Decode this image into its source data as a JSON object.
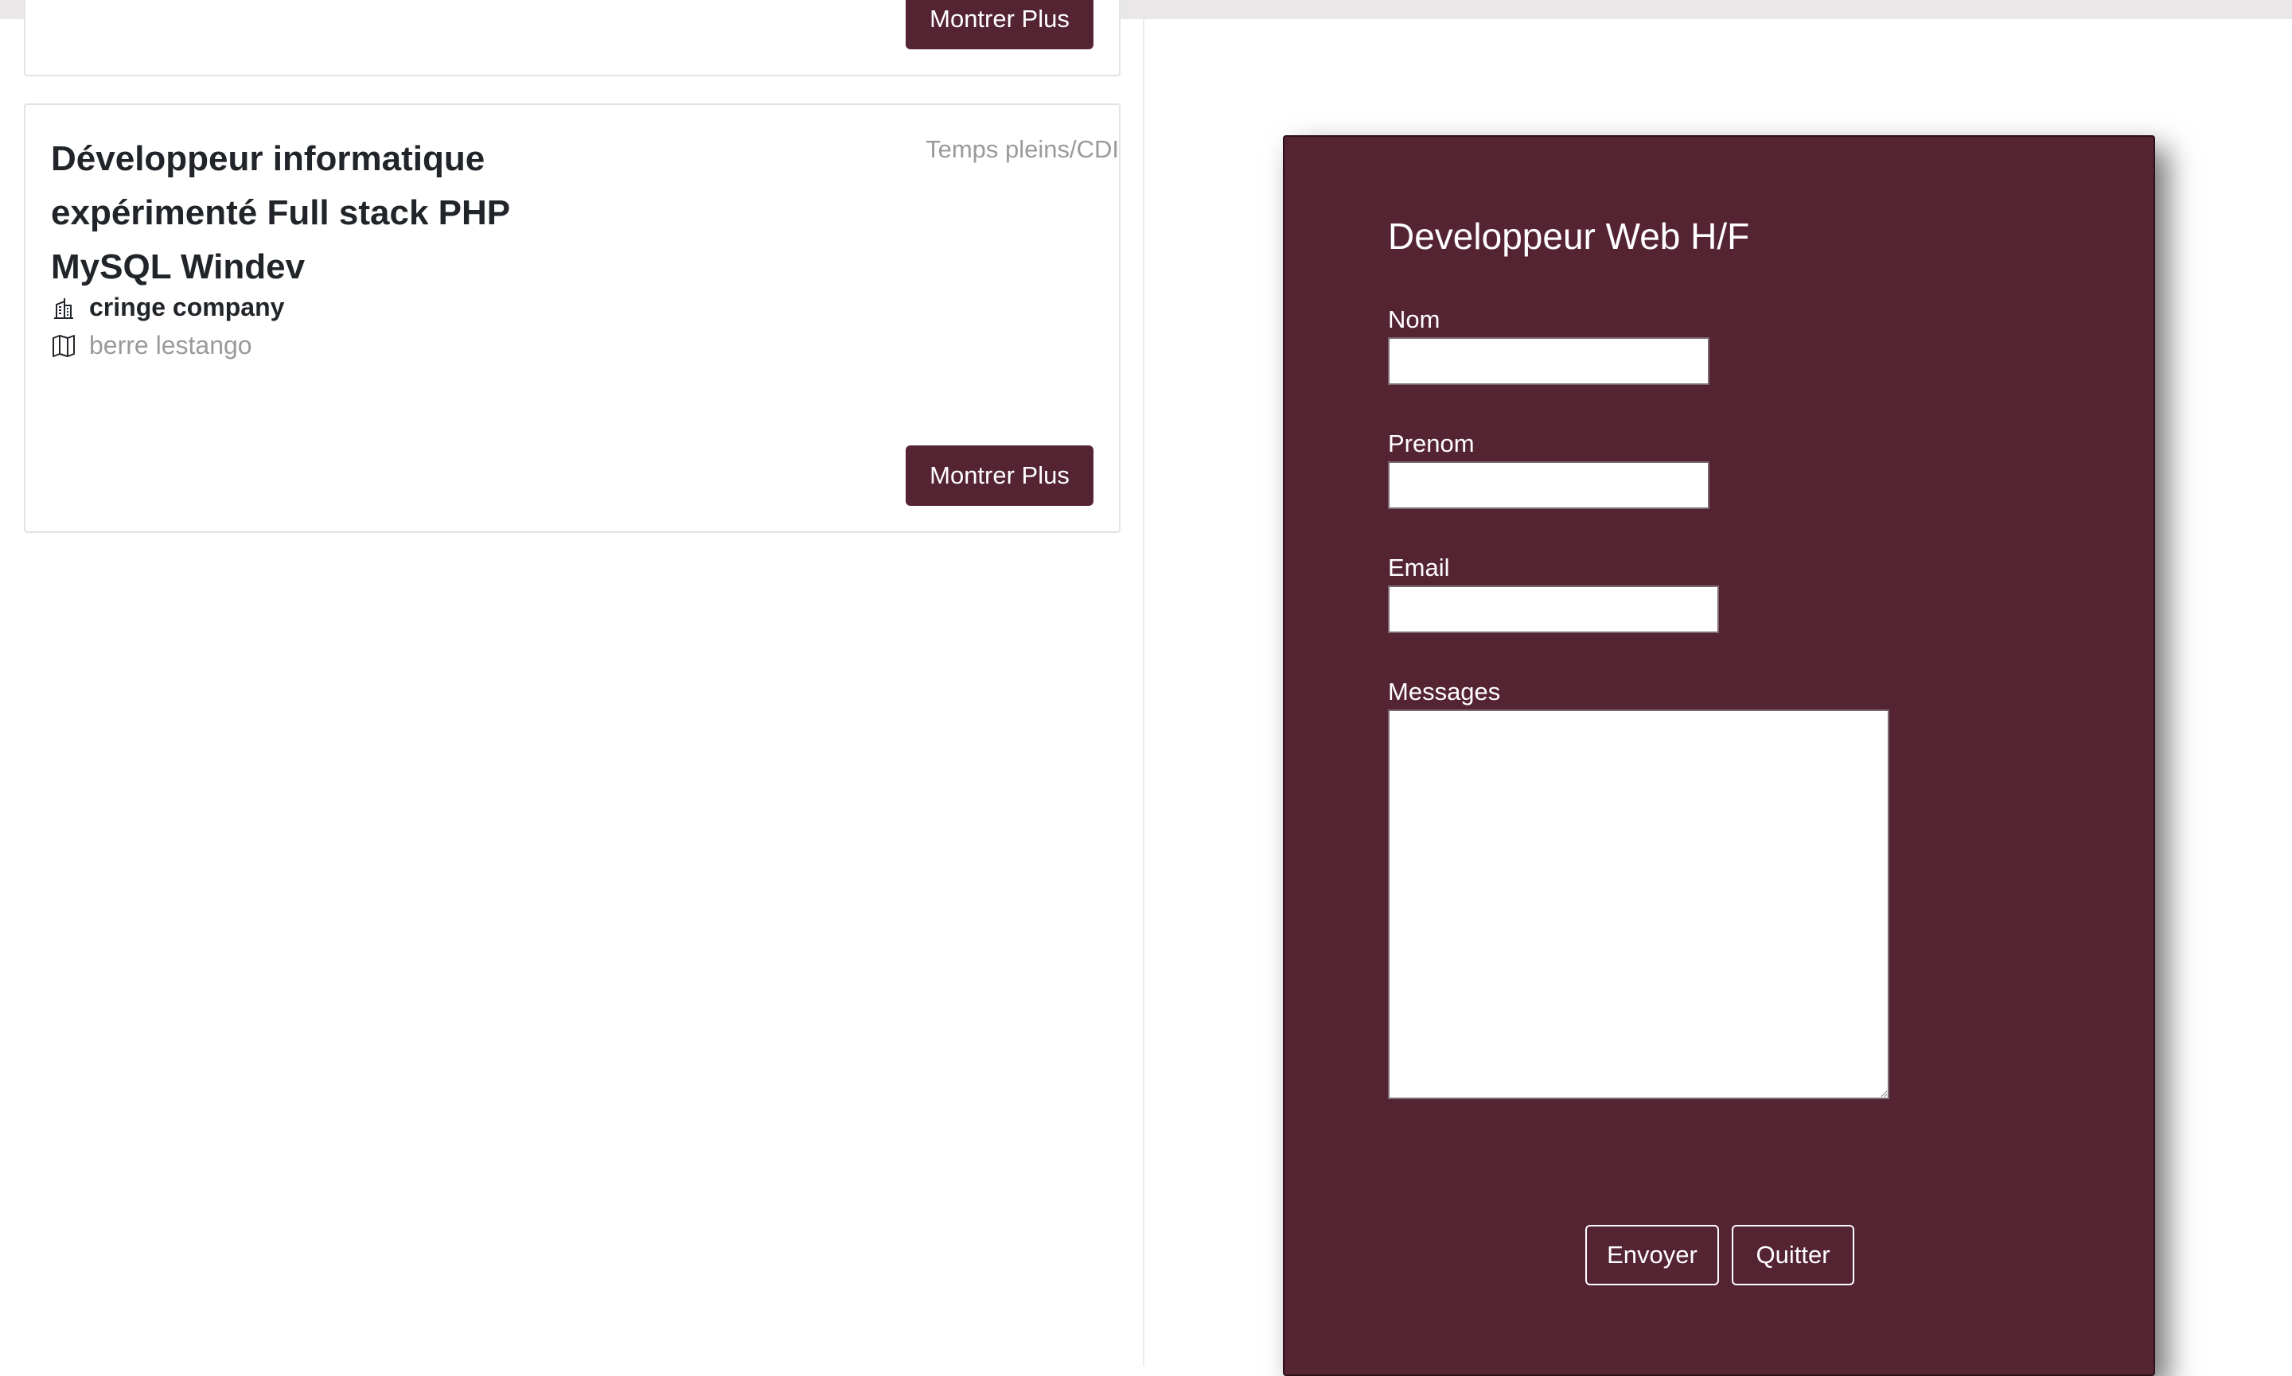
{
  "job_list": {
    "previous_card": {
      "button_label": "Montrer Plus"
    },
    "card": {
      "title": "Développeur informatique expérimenté Full stack PHP MySQL Windev",
      "contract_type": "Temps pleins/CDI",
      "company_icon": "building-icon",
      "company": "cringe company",
      "location_icon": "map-icon",
      "location": "berre lestango",
      "button_label": "Montrer Plus"
    }
  },
  "modal": {
    "title": "Developpeur Web H/F",
    "fields": {
      "nom": {
        "label": "Nom",
        "value": ""
      },
      "prenom": {
        "label": "Prenom",
        "value": ""
      },
      "email": {
        "label": "Email",
        "value": ""
      },
      "messages": {
        "label": "Messages",
        "value": ""
      }
    },
    "submit_label": "Envoyer",
    "quit_label": "Quitter"
  },
  "colors": {
    "accent": "#552433",
    "muted_text": "#9a9a9a",
    "heading_text": "#212529"
  }
}
